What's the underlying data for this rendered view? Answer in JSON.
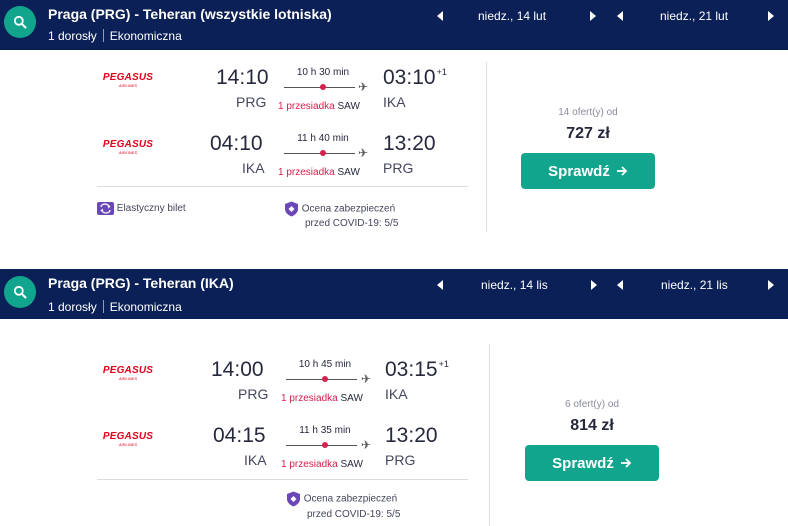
{
  "results": [
    {
      "header": {
        "route": "Praga (PRG) - Teheran (wszystkie lotniska)",
        "passengers": "1 dorosły",
        "cabin": "Ekonomiczna",
        "outbound_date": "niedz., 14 lut",
        "return_date": "niedz., 21 lut"
      },
      "legs": [
        {
          "airline": "PEGASUS",
          "airline_sub": "AIRLINES",
          "dep_time": "14:10",
          "dep_code": "PRG",
          "duration": "10 h 30 min",
          "stops": "1 przesiadka",
          "hub": "SAW",
          "arr_time": "03:10",
          "day_offset": "+1",
          "arr_code": "IKA"
        },
        {
          "airline": "PEGASUS",
          "airline_sub": "AIRLINES",
          "dep_time": "04:10",
          "dep_code": "IKA",
          "duration": "11 h 40 min",
          "stops": "1 przesiadka",
          "hub": "SAW",
          "arr_time": "13:20",
          "day_offset": "",
          "arr_code": "PRG"
        }
      ],
      "flex_ticket": "Elastyczny bilet",
      "covid_line1": "Ocena zabezpieczeń",
      "covid_line2": "przed COVID-19: 5/5",
      "offers": "14 ofert(y) od",
      "price": "727 zł",
      "cta": "Sprawdź"
    },
    {
      "header": {
        "route": "Praga (PRG) - Teheran (IKA)",
        "passengers": "1 dorosły",
        "cabin": "Ekonomiczna",
        "outbound_date": "niedz., 14 lis",
        "return_date": "niedz., 21 lis"
      },
      "legs": [
        {
          "airline": "PEGASUS",
          "airline_sub": "AIRLINES",
          "dep_time": "14:00",
          "dep_code": "PRG",
          "duration": "10 h 45 min",
          "stops": "1 przesiadka",
          "hub": "SAW",
          "arr_time": "03:15",
          "day_offset": "+1",
          "arr_code": "IKA"
        },
        {
          "airline": "PEGASUS",
          "airline_sub": "AIRLINES",
          "dep_time": "04:15",
          "dep_code": "IKA",
          "duration": "11 h 35 min",
          "stops": "1 przesiadka",
          "hub": "SAW",
          "arr_time": "13:20",
          "day_offset": "",
          "arr_code": "PRG"
        }
      ],
      "covid_line1": "Ocena zabezpieczeń",
      "covid_line2": "przed COVID-19: 5/5",
      "offers": "6 ofert(y) od",
      "price": "814 zł",
      "cta": "Sprawdź"
    }
  ],
  "colors": {
    "header_bg": "#0b2057",
    "accent": "#12a58e",
    "brand_red": "#e2001a",
    "stop_red": "#d6204d"
  }
}
